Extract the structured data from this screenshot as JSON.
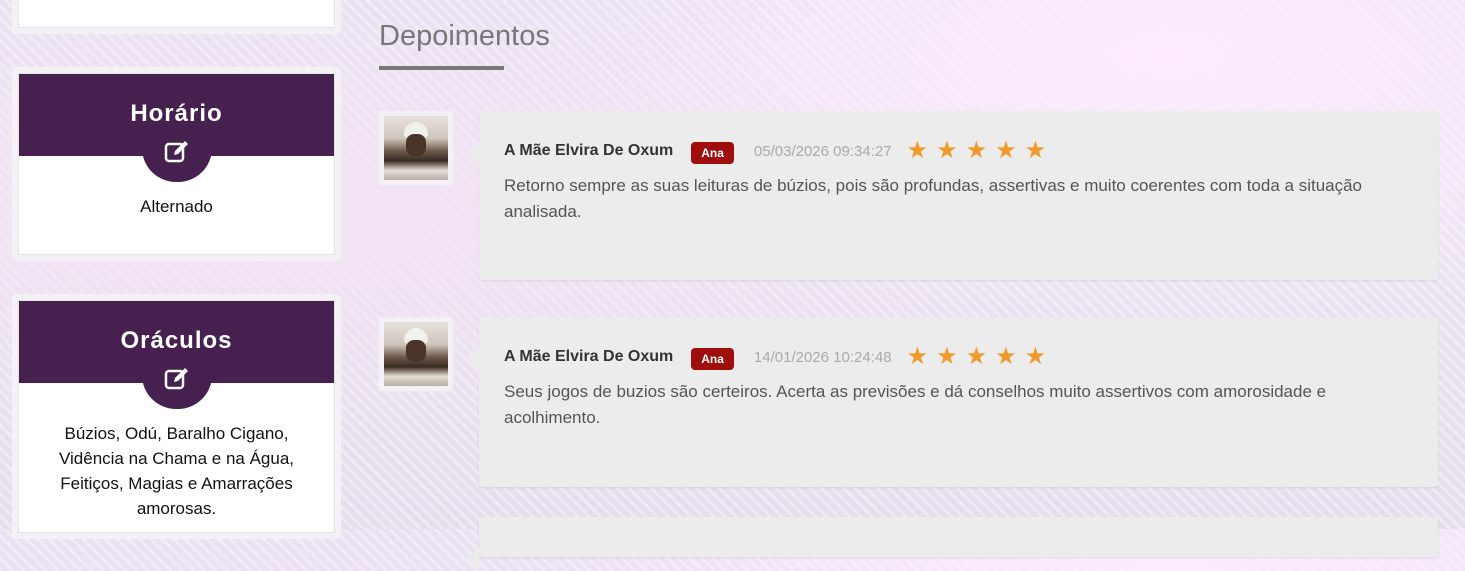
{
  "sidebar": {
    "horario": {
      "title": "Horário",
      "text": "Alternado",
      "icon": "edit-icon"
    },
    "oraculos": {
      "title": "Oráculos",
      "text": "Búzios, Odú, Baralho Cigano, Vidência na Chama e na Água, Feitiços, Magias e Amarrações amorosas.",
      "icon": "edit-icon"
    }
  },
  "main": {
    "title": "Depoimentos",
    "reviews": [
      {
        "author": "A Mãe Elvira De Oxum",
        "badge": "Ana",
        "date": "05/03/2026 09:34:27",
        "rating": 5,
        "text": "Retorno sempre as suas leituras de búzios, pois são profundas, assertivas e muito coerentes com toda a situação analisada."
      },
      {
        "author": "A Mãe Elvira De Oxum",
        "badge": "Ana",
        "date": "14/01/2026 10:24:48",
        "rating": 5,
        "text": "Seus jogos de buzios são certeiros. Acerta as previsões e dá conselhos muito assertivos com amorosidade e acolhimento."
      }
    ]
  },
  "colors": {
    "accent": "#46204f",
    "badge": "#a00d0d",
    "star": "#ef9a2a"
  }
}
